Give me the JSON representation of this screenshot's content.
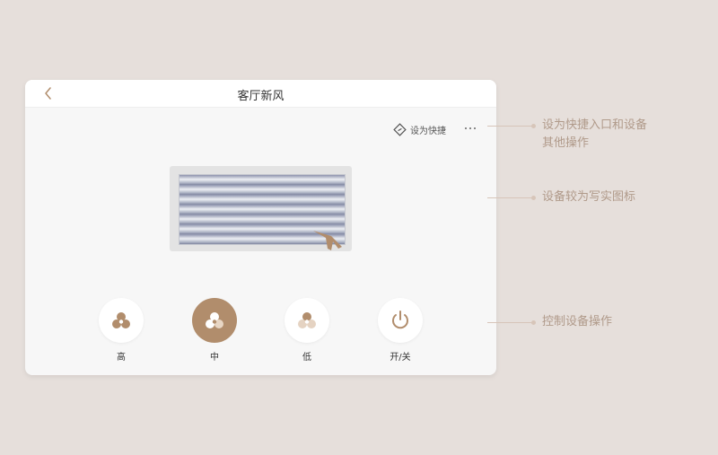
{
  "header": {
    "back_icon": "chevron-left-icon",
    "title": "客厅新风"
  },
  "toolbar": {
    "shortcut_icon": "shortcut-diamond-icon",
    "shortcut_label": "设为快捷",
    "more_icon": "more-dots-icon"
  },
  "device": {
    "image": "fresh-air-unit-realistic-icon"
  },
  "controls": [
    {
      "label": "高",
      "icon": "fan-high-icon",
      "active": false
    },
    {
      "label": "中",
      "icon": "fan-medium-icon",
      "active": true
    },
    {
      "label": "低",
      "icon": "fan-low-icon",
      "active": false
    },
    {
      "label": "开/关",
      "icon": "power-icon",
      "active": false
    }
  ],
  "annotations": {
    "a1_line1": "设为快捷入口和设备",
    "a1_line2": "其他操作",
    "a2": "设备较为写实图标",
    "a3": "控制设备操作"
  },
  "colors": {
    "background": "#e6dfdb",
    "card": "#f7f7f7",
    "accent": "#b18d6c",
    "annotation_text": "#b09a8a",
    "annotation_line": "#d7c5b9"
  }
}
